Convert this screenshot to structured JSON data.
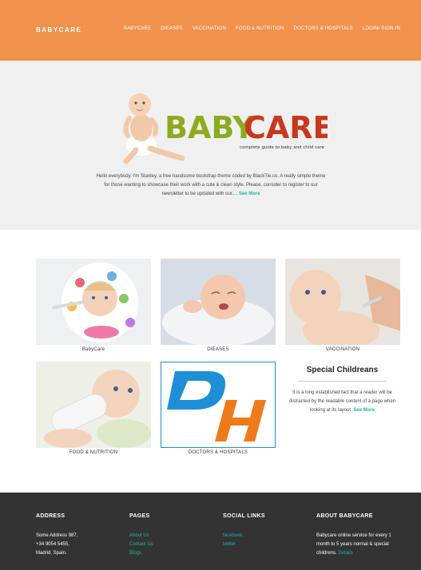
{
  "header": {
    "brand": "BABYCARE",
    "nav": [
      "BABYCARE",
      "DIEASES",
      "VACCINATION",
      "FOOD & NUTRITION",
      "DOCTORS & HOSPITALS",
      "LOGIN/ SIGN IN"
    ]
  },
  "hero": {
    "logo_word_1": "BABY",
    "logo_word_2": "CARE",
    "tagline": "complete guide to baby and child care",
    "intro": "Hello everybody. I'm Stanley, a free handsome bootstrap theme coded by BlackTie.co. A really simple theme for those wanting to showcase their work with a cute & clean style. Please, consider to register to our newsletter to be updated with our....",
    "more": "See More"
  },
  "cards": [
    {
      "caption": "BabyCare"
    },
    {
      "caption": "DIEASES"
    },
    {
      "caption": "VACCINATION"
    },
    {
      "caption": "FOOD & NUTRITION"
    },
    {
      "caption": "DOCTORS & HOSPITALS"
    }
  ],
  "special": {
    "title": "Special Childreans",
    "text": "It is a long established fact that a reader will be distracted by the readable content of a page when looking at its layout.",
    "more": "See More"
  },
  "footer": {
    "address": {
      "title": "ADDRESS",
      "lines": [
        "Some Address 987,",
        "+34 9054 5455,",
        "Madrid, Spain."
      ]
    },
    "pages": {
      "title": "PAGES",
      "links": [
        "About Us",
        "Contact Us",
        "Blogs"
      ]
    },
    "social": {
      "title": "SOCIAL LINKS",
      "links": [
        "facebook",
        "twitter"
      ]
    },
    "about": {
      "title": "ABOUT BABYCARE",
      "text": "Babycare online service for every 1 month to 5 years normal & special childrens.",
      "link": "Details"
    }
  },
  "colors": {
    "header": "#f0924b",
    "accent": "#1cb5a7",
    "footer": "#333333",
    "logo_green": "#8cab1e",
    "logo_red": "#c9381e",
    "dh_blue": "#1e8fd6",
    "dh_orange": "#ef7a1a"
  }
}
